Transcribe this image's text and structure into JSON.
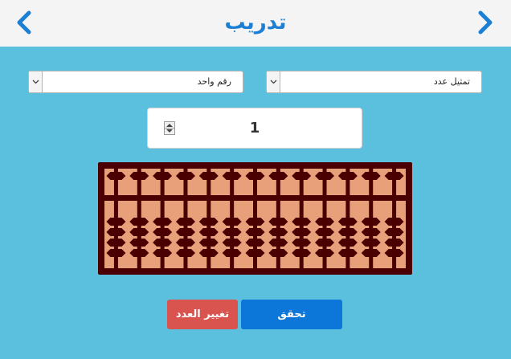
{
  "header": {
    "title": "تدريب",
    "back_icon": "chevron-left-icon",
    "forward_icon": "chevron-right-icon",
    "accent_color": "#1c7fd3"
  },
  "controls": {
    "digits_select": {
      "value": "رقم واحد"
    },
    "mode_select": {
      "value": "تمثيل عدد"
    },
    "number_input": {
      "value": "1"
    }
  },
  "abacus": {
    "rods": 13,
    "upper_beads_per_rod": 1,
    "lower_beads_per_rod": 4,
    "frame_color": "#4a0000",
    "bead_color": "#4a0000",
    "background_color": "#e8a07b"
  },
  "buttons": {
    "check_label": "تحقق",
    "change_number_label": "تغيير العدد",
    "check_color": "#0c77d8",
    "change_color": "#d9534f"
  }
}
